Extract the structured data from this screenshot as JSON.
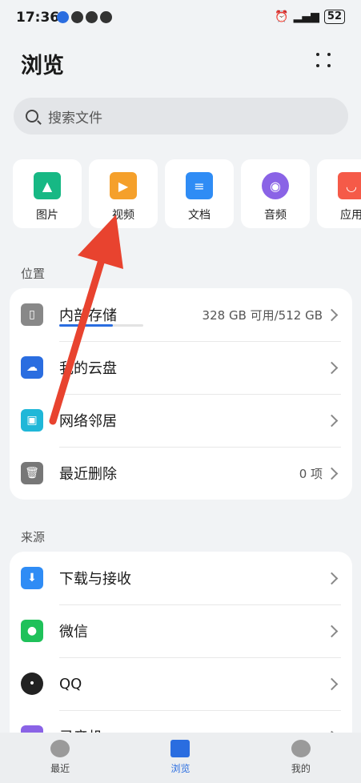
{
  "status": {
    "time": "17:36",
    "battery": "52"
  },
  "header": {
    "title": "浏览"
  },
  "search": {
    "placeholder": "搜索文件"
  },
  "categories": [
    {
      "label": "图片",
      "color": "#17b884"
    },
    {
      "label": "视频",
      "color": "#f5a02b"
    },
    {
      "label": "文档",
      "color": "#2f8cf5"
    },
    {
      "label": "音频",
      "color": "#8a63e6"
    },
    {
      "label": "应用",
      "color": "#f55a48"
    }
  ],
  "location": {
    "title": "位置",
    "items": [
      {
        "label": "内部存储",
        "value": "328 GB 可用/512 GB",
        "color": "#888888"
      },
      {
        "label": "我的云盘",
        "value": "",
        "color": "#2a6de0"
      },
      {
        "label": "网络邻居",
        "value": "",
        "color": "#1fb7d8"
      },
      {
        "label": "最近删除",
        "value": "0 项",
        "color": "#777777"
      }
    ]
  },
  "source": {
    "title": "来源",
    "items": [
      {
        "label": "下载与接收",
        "color": "#2f8cf5"
      },
      {
        "label": "微信",
        "color": "#1fc15a"
      },
      {
        "label": "QQ",
        "color": "#222222"
      },
      {
        "label": "录音机",
        "color": "#8a63e6"
      }
    ]
  },
  "nav": [
    {
      "label": "最近"
    },
    {
      "label": "浏览"
    },
    {
      "label": "我的"
    }
  ]
}
